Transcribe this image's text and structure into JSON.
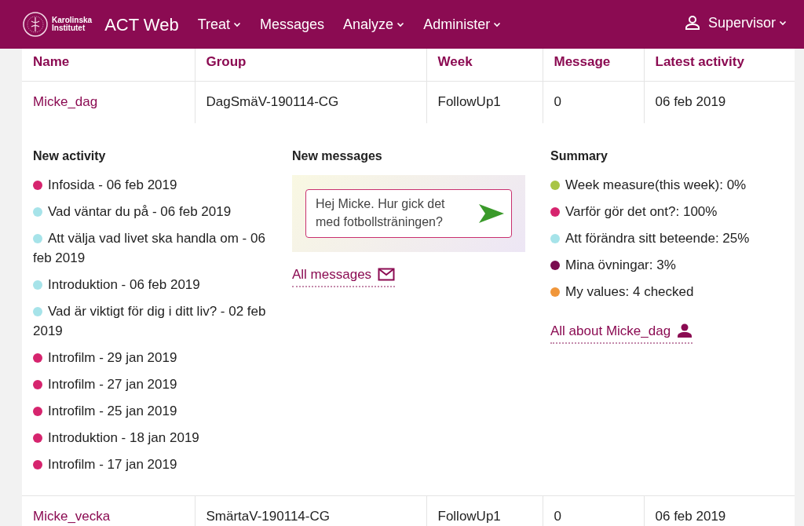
{
  "navbar": {
    "logo_lines": [
      "Karolinska",
      "Institutet"
    ],
    "brand": "ACT Web",
    "menu": [
      {
        "label": "Treat",
        "dropdown": true
      },
      {
        "label": "Messages",
        "dropdown": false
      },
      {
        "label": "Analyze",
        "dropdown": true
      },
      {
        "label": "Administer",
        "dropdown": true
      }
    ],
    "user": {
      "label": "Supervisor",
      "dropdown": true
    }
  },
  "table": {
    "columns": [
      "Name",
      "Group",
      "Week",
      "Message",
      "Latest activity"
    ],
    "rows": [
      {
        "name": "Micke_dag",
        "group": "DagSmäV-190114-CG",
        "week": "FollowUp1",
        "message": "0",
        "latest_activity": "06 feb 2019",
        "expanded": true,
        "details": {
          "new_activity": {
            "title": "New activity",
            "items": [
              {
                "text": "Infosida - 06 feb 2019",
                "color": "#d6246e"
              },
              {
                "text": "Vad väntar du på - 06 feb 2019",
                "color": "#a6e3e9"
              },
              {
                "text": "Att välja vad livet ska handla om - 06 feb 2019",
                "color": "#a6e3e9"
              },
              {
                "text": "Introduktion - 06 feb 2019",
                "color": "#a6e3e9"
              },
              {
                "text": "Vad är viktigt för dig i ditt liv? - 02 feb 2019",
                "color": "#a6e3e9"
              },
              {
                "text": "Introfilm - 29 jan 2019",
                "color": "#d6246e"
              },
              {
                "text": "Introfilm - 27 jan 2019",
                "color": "#d6246e"
              },
              {
                "text": "Introfilm - 25 jan 2019",
                "color": "#d6246e"
              },
              {
                "text": "Introduktion - 18 jan 2019",
                "color": "#d6246e"
              },
              {
                "text": "Introfilm - 17 jan 2019",
                "color": "#d6246e"
              }
            ]
          },
          "new_messages": {
            "title": "New messages",
            "message_value": "Hej Micke. Hur gick det med fotbollsträningen?",
            "link": "All messages"
          },
          "summary": {
            "title": "Summary",
            "items": [
              {
                "text": "Week measure(this week): 0%",
                "color": "#a8c545"
              },
              {
                "text": "Varför gör det ont?: 100%",
                "color": "#d6246e"
              },
              {
                "text": "Att förändra sitt beteende: 25%",
                "color": "#a6e3e9"
              },
              {
                "text": "Mina övningar: 3%",
                "color": "#7a0d4f"
              },
              {
                "text": "My values: 4 checked",
                "color": "#f0963a"
              }
            ],
            "link": "All about Micke_dag"
          }
        }
      },
      {
        "name": "Micke_vecka",
        "group": "SmärtaV-190114-CG",
        "week": "FollowUp1",
        "message": "0",
        "latest_activity": "06 feb 2019",
        "expanded": false
      }
    ]
  }
}
